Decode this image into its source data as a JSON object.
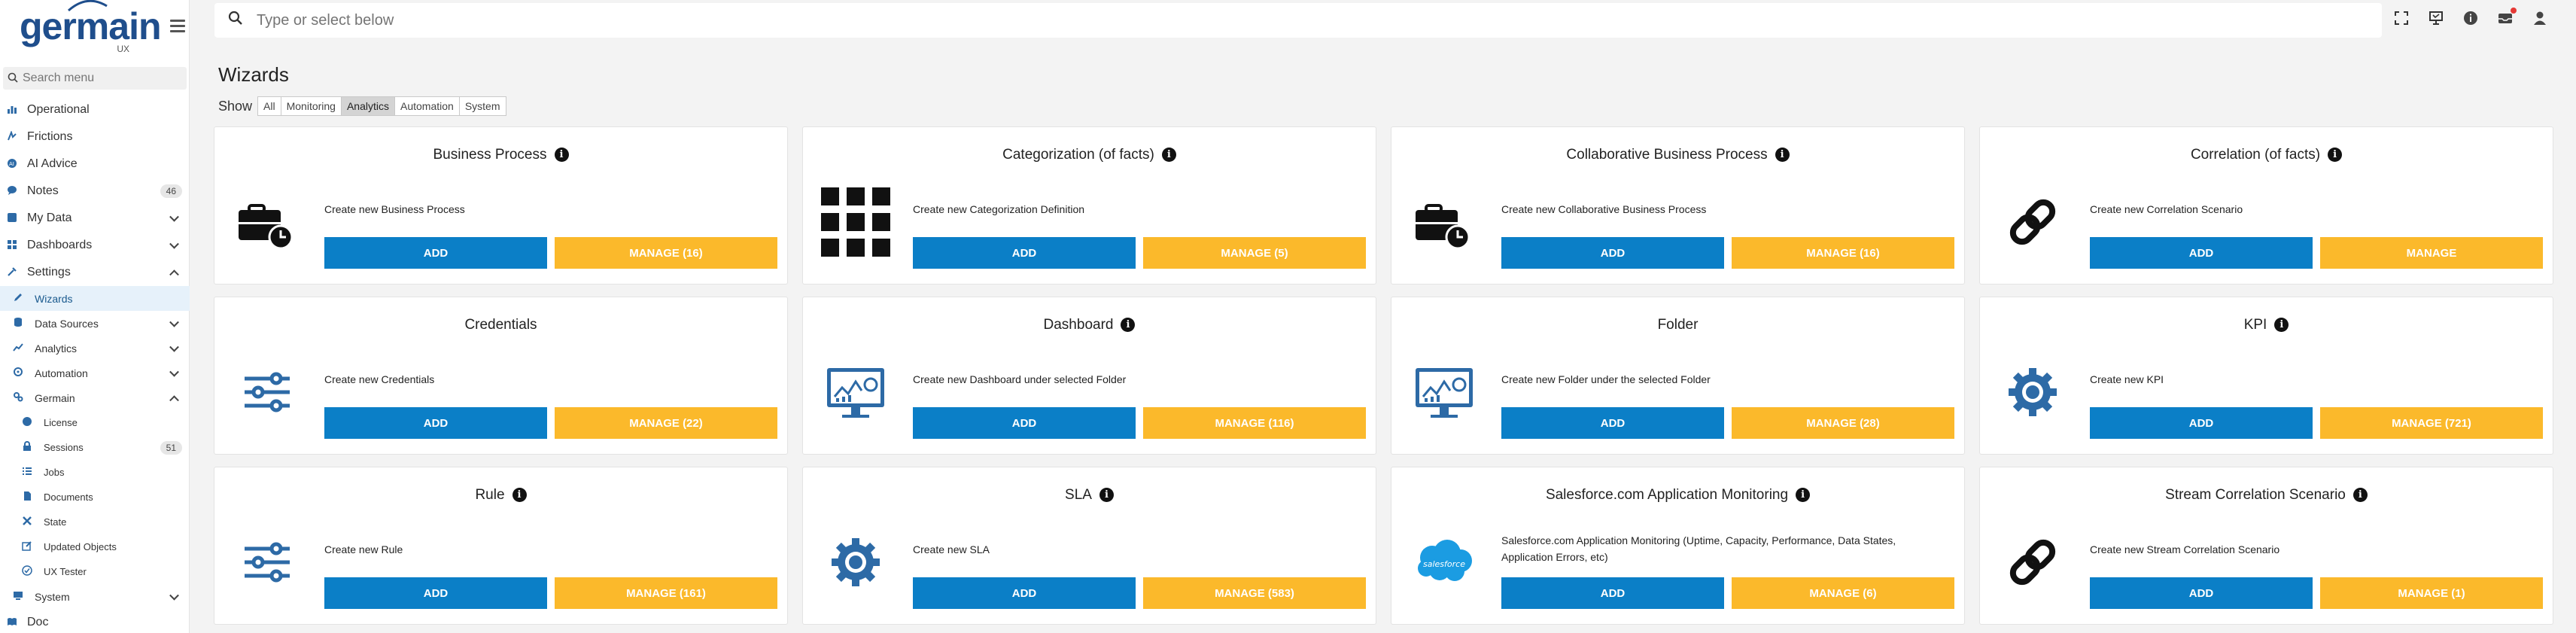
{
  "brand": {
    "name": "germain",
    "sub": "UX",
    "logo_icon": "germain-logo"
  },
  "sidebar": {
    "search_placeholder": "Search menu",
    "items": [
      {
        "label": "Operational",
        "icon": "bar-chart-icon"
      },
      {
        "label": "Frictions",
        "icon": "friction-icon"
      },
      {
        "label": "AI Advice",
        "icon": "ai-icon"
      },
      {
        "label": "Notes",
        "icon": "chat-icon",
        "badge": "46"
      },
      {
        "label": "My Data",
        "icon": "data-icon"
      },
      {
        "label": "Dashboards",
        "icon": "dashboard-icon"
      },
      {
        "label": "Settings",
        "icon": "settings-icon"
      },
      {
        "label": "Wizards",
        "icon": "pencil-icon"
      },
      {
        "label": "Data Sources",
        "icon": "database-icon"
      },
      {
        "label": "Analytics",
        "icon": "analytics-icon"
      },
      {
        "label": "Automation",
        "icon": "automation-icon"
      },
      {
        "label": "Germain",
        "icon": "gear-icon"
      },
      {
        "label": "License",
        "icon": "license-icon"
      },
      {
        "label": "Sessions",
        "icon": "lock-icon",
        "badge": "51"
      },
      {
        "label": "Jobs",
        "icon": "list-icon"
      },
      {
        "label": "Documents",
        "icon": "document-icon"
      },
      {
        "label": "State",
        "icon": "state-icon"
      },
      {
        "label": "Updated Objects",
        "icon": "edit-icon"
      },
      {
        "label": "UX Tester",
        "icon": "check-icon"
      },
      {
        "label": "System",
        "icon": "system-icon"
      },
      {
        "label": "Doc",
        "icon": "doc-icon"
      }
    ]
  },
  "topbar": {
    "search_placeholder": "Type or select below",
    "icons": [
      "fullscreen-icon",
      "presentation-icon",
      "info-icon",
      "inbox-icon",
      "user-icon"
    ]
  },
  "page": {
    "title": "Wizards",
    "show_label": "Show",
    "filters": [
      {
        "label": "All",
        "active": false
      },
      {
        "label": "Monitoring",
        "active": false
      },
      {
        "label": "Analytics",
        "active": true
      },
      {
        "label": "Automation",
        "active": false
      },
      {
        "label": "System",
        "active": false
      }
    ]
  },
  "cards": [
    {
      "title": "Business Process",
      "info": true,
      "desc": "Create new Business Process",
      "add": "ADD",
      "manage": "MANAGE (16)",
      "icon": "briefcase-clock-icon"
    },
    {
      "title": "Categorization (of facts)",
      "info": true,
      "desc": "Create new Categorization Definition",
      "add": "ADD",
      "manage": "MANAGE (5)",
      "icon": "grid-icon"
    },
    {
      "title": "Collaborative Business Process",
      "info": true,
      "desc": "Create new Collaborative Business Process",
      "add": "ADD",
      "manage": "MANAGE (16)",
      "icon": "briefcase-clock-icon"
    },
    {
      "title": "Correlation (of facts)",
      "info": true,
      "desc": "Create new Correlation Scenario",
      "add": "ADD",
      "manage": "MANAGE",
      "icon": "link-icon"
    },
    {
      "title": "Credentials",
      "info": false,
      "desc": "Create new Credentials",
      "add": "ADD",
      "manage": "MANAGE (22)",
      "icon": "sliders-icon"
    },
    {
      "title": "Dashboard",
      "info": true,
      "desc": "Create new Dashboard under selected Folder",
      "add": "ADD",
      "manage": "MANAGE (116)",
      "icon": "monitor-chart-icon"
    },
    {
      "title": "Folder",
      "info": false,
      "desc": "Create new Folder under the selected Folder",
      "add": "ADD",
      "manage": "MANAGE (28)",
      "icon": "monitor-chart-icon"
    },
    {
      "title": "KPI",
      "info": true,
      "desc": "Create new KPI",
      "add": "ADD",
      "manage": "MANAGE (721)",
      "icon": "gear-icon"
    },
    {
      "title": "Rule",
      "info": true,
      "desc": "Create new Rule",
      "add": "ADD",
      "manage": "MANAGE (161)",
      "icon": "sliders-icon"
    },
    {
      "title": "SLA",
      "info": true,
      "desc": "Create new SLA",
      "add": "ADD",
      "manage": "MANAGE (583)",
      "icon": "gear-icon"
    },
    {
      "title": "Salesforce.com Application Monitoring",
      "info": true,
      "desc": "Salesforce.com Application Monitoring (Uptime, Capacity, Performance, Data States, Application Errors, etc)",
      "add": "ADD",
      "manage": "MANAGE (6)",
      "icon": "salesforce-icon"
    },
    {
      "title": "Stream Correlation Scenario",
      "info": true,
      "desc": "Create new Stream Correlation Scenario",
      "add": "ADD",
      "manage": "MANAGE (1)",
      "icon": "link-icon"
    }
  ],
  "colors": {
    "add": "#0b7fc7",
    "manage": "#fbb92b",
    "accent": "#2d6aa6"
  }
}
